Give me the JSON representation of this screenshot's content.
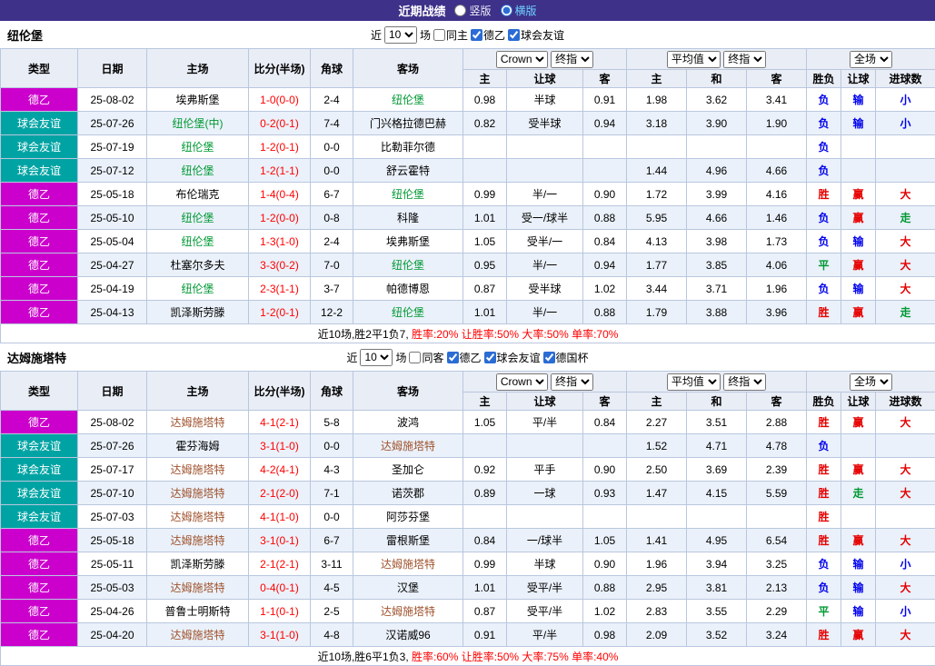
{
  "topbar": {
    "title": "近期战绩",
    "view_options": [
      {
        "label": "竖版",
        "selected": false
      },
      {
        "label": "横版",
        "selected": true
      }
    ]
  },
  "header_labels": {
    "type": "类型",
    "date": "日期",
    "home": "主场",
    "score": "比分(半场)",
    "corner": "角球",
    "away": "客场",
    "asian_selects": [
      "Crown",
      "终指"
    ],
    "asian_sub": [
      "主",
      "让球",
      "客"
    ],
    "euro_selects": [
      "平均值",
      "终指"
    ],
    "euro_sub": [
      "主",
      "和",
      "客"
    ],
    "result_select": "全场",
    "result_sub": [
      "胜负",
      "让球",
      "进球数"
    ]
  },
  "colors": {
    "topbar_bg": "#3d3189",
    "league": {
      "德乙": "#cc00cc",
      "球会友谊": "#00a3a3"
    },
    "team_highlight": {
      "纽伦堡": "#009933",
      "达姆施塔特": "#a0522d"
    },
    "result": {
      "胜": "#e60000",
      "平": "#009933",
      "负": "#0000ee",
      "赢": "#e60000",
      "走": "#009933",
      "输": "#0000ee",
      "大": "#e60000",
      "小": "#0000ee"
    }
  },
  "sections": [
    {
      "team": "纽伦堡",
      "filter": {
        "near": "近",
        "count": "10",
        "games": "场",
        "checkboxes": [
          {
            "label": "同主",
            "checked": false
          },
          {
            "label": "德乙",
            "checked": true
          },
          {
            "label": "球会友谊",
            "checked": true
          }
        ]
      },
      "rows": [
        [
          "德乙",
          "25-08-02",
          "埃弗斯堡",
          "1-0(0-0)",
          "2-4",
          "纽伦堡",
          "0.98",
          "半球",
          "0.91",
          "1.98",
          "3.62",
          "3.41",
          "负",
          "输",
          "小"
        ],
        [
          "球会友谊",
          "25-07-26",
          "纽伦堡(中)",
          "0-2(0-1)",
          "7-4",
          "门兴格拉德巴赫",
          "0.82",
          "受半球",
          "0.94",
          "3.18",
          "3.90",
          "1.90",
          "负",
          "输",
          "小"
        ],
        [
          "球会友谊",
          "25-07-19",
          "纽伦堡",
          "1-2(0-1)",
          "0-0",
          "比勒菲尔德",
          "",
          "",
          "",
          "",
          "",
          "",
          "负",
          "",
          ""
        ],
        [
          "球会友谊",
          "25-07-12",
          "纽伦堡",
          "1-2(1-1)",
          "0-0",
          "舒云霍特",
          "",
          "",
          "",
          "1.44",
          "4.96",
          "4.66",
          "负",
          "",
          ""
        ],
        [
          "德乙",
          "25-05-18",
          "布伦瑞克",
          "1-4(0-4)",
          "6-7",
          "纽伦堡",
          "0.99",
          "半/一",
          "0.90",
          "1.72",
          "3.99",
          "4.16",
          "胜",
          "赢",
          "大"
        ],
        [
          "德乙",
          "25-05-10",
          "纽伦堡",
          "1-2(0-0)",
          "0-8",
          "科隆",
          "1.01",
          "受一/球半",
          "0.88",
          "5.95",
          "4.66",
          "1.46",
          "负",
          "赢",
          "走"
        ],
        [
          "德乙",
          "25-05-04",
          "纽伦堡",
          "1-3(1-0)",
          "2-4",
          "埃弗斯堡",
          "1.05",
          "受半/一",
          "0.84",
          "4.13",
          "3.98",
          "1.73",
          "负",
          "输",
          "大"
        ],
        [
          "德乙",
          "25-04-27",
          "杜塞尔多夫",
          "3-3(0-2)",
          "7-0",
          "纽伦堡",
          "0.95",
          "半/一",
          "0.94",
          "1.77",
          "3.85",
          "4.06",
          "平",
          "赢",
          "大"
        ],
        [
          "德乙",
          "25-04-19",
          "纽伦堡",
          "2-3(1-1)",
          "3-7",
          "帕德博恩",
          "0.87",
          "受半球",
          "1.02",
          "3.44",
          "3.71",
          "1.96",
          "负",
          "输",
          "大"
        ],
        [
          "德乙",
          "25-04-13",
          "凯泽斯劳滕",
          "1-2(0-1)",
          "12-2",
          "纽伦堡",
          "1.01",
          "半/一",
          "0.88",
          "1.79",
          "3.88",
          "3.96",
          "胜",
          "赢",
          "走"
        ]
      ],
      "summary_plain": "近10场,胜2平1负7,",
      "summary_stats": "胜率:20% 让胜率:50% 大率:50% 单率:70%"
    },
    {
      "team": "达姆施塔特",
      "filter": {
        "near": "近",
        "count": "10",
        "games": "场",
        "checkboxes": [
          {
            "label": "同客",
            "checked": false
          },
          {
            "label": "德乙",
            "checked": true
          },
          {
            "label": "球会友谊",
            "checked": true
          },
          {
            "label": "德国杯",
            "checked": true
          }
        ]
      },
      "rows": [
        [
          "德乙",
          "25-08-02",
          "达姆施塔特",
          "4-1(2-1)",
          "5-8",
          "波鸿",
          "1.05",
          "平/半",
          "0.84",
          "2.27",
          "3.51",
          "2.88",
          "胜",
          "赢",
          "大"
        ],
        [
          "球会友谊",
          "25-07-26",
          "霍芬海姆",
          "3-1(1-0)",
          "0-0",
          "达姆施塔特",
          "",
          "",
          "",
          "1.52",
          "4.71",
          "4.78",
          "负",
          "",
          ""
        ],
        [
          "球会友谊",
          "25-07-17",
          "达姆施塔特",
          "4-2(4-1)",
          "4-3",
          "圣加仑",
          "0.92",
          "平手",
          "0.90",
          "2.50",
          "3.69",
          "2.39",
          "胜",
          "赢",
          "大"
        ],
        [
          "球会友谊",
          "25-07-10",
          "达姆施塔特",
          "2-1(2-0)",
          "7-1",
          "诺茨郡",
          "0.89",
          "一球",
          "0.93",
          "1.47",
          "4.15",
          "5.59",
          "胜",
          "走",
          "大"
        ],
        [
          "球会友谊",
          "25-07-03",
          "达姆施塔特",
          "4-1(1-0)",
          "0-0",
          "阿莎芬堡",
          "",
          "",
          "",
          "",
          "",
          "",
          "胜",
          "",
          ""
        ],
        [
          "德乙",
          "25-05-18",
          "达姆施塔特",
          "3-1(0-1)",
          "6-7",
          "雷根斯堡",
          "0.84",
          "一/球半",
          "1.05",
          "1.41",
          "4.95",
          "6.54",
          "胜",
          "赢",
          "大"
        ],
        [
          "德乙",
          "25-05-11",
          "凯泽斯劳滕",
          "2-1(2-1)",
          "3-11",
          "达姆施塔特",
          "0.99",
          "半球",
          "0.90",
          "1.96",
          "3.94",
          "3.25",
          "负",
          "输",
          "小"
        ],
        [
          "德乙",
          "25-05-03",
          "达姆施塔特",
          "0-4(0-1)",
          "4-5",
          "汉堡",
          "1.01",
          "受平/半",
          "0.88",
          "2.95",
          "3.81",
          "2.13",
          "负",
          "输",
          "大"
        ],
        [
          "德乙",
          "25-04-26",
          "普鲁士明斯特",
          "1-1(0-1)",
          "2-5",
          "达姆施塔特",
          "0.87",
          "受平/半",
          "1.02",
          "2.83",
          "3.55",
          "2.29",
          "平",
          "输",
          "小"
        ],
        [
          "德乙",
          "25-04-20",
          "达姆施塔特",
          "3-1(1-0)",
          "4-8",
          "汉诺威96",
          "0.91",
          "平/半",
          "0.98",
          "2.09",
          "3.52",
          "3.24",
          "胜",
          "赢",
          "大"
        ]
      ],
      "summary_plain": "近10场,胜6平1负3,",
      "summary_stats": "胜率:60% 让胜率:50% 大率:75% 单率:40%"
    }
  ]
}
